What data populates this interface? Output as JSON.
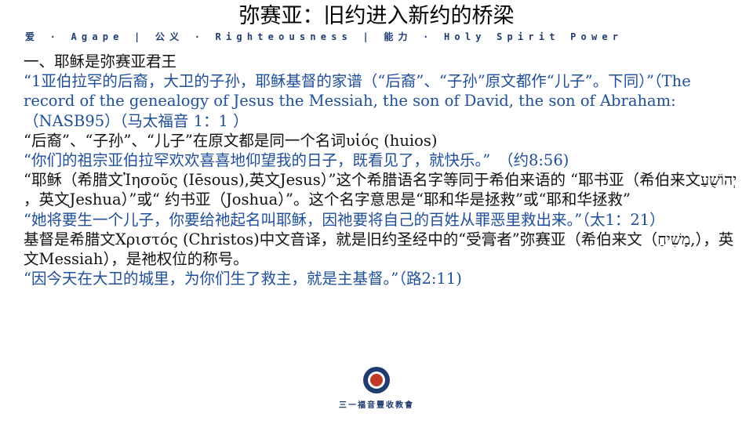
{
  "title": "弥赛亚：旧约进入新约的桥梁",
  "motto": "爱 · Agape | 公义 · Righteousness | 能力 · Holy Spirit Power",
  "paragraphs": [
    {
      "style": "heading",
      "text": "一、耶稣是弥赛亚君王"
    },
    {
      "style": "blue",
      "text": "“1亚伯拉罕的后裔，大卫的子孙，耶稣基督的家谱（“后裔”、“子孙”原文都作“儿子”。下同）”（The record of the genealogy of Jesus the Messiah, the son of David, the son of Abraham:（NASB95）（马太福音 1：1 ）"
    },
    {
      "style": "black",
      "text": "“后裔”、“子孙”、“儿子”在原文都是同一个名词υἱός (huios)"
    },
    {
      "style": "blue",
      "text": "“你们的祖宗亚伯拉罕欢欢喜喜地仰望我的日子，既看见了，就快乐。”　（约8:56)"
    },
    {
      "style": "black",
      "text": "“耶稣（希腊文Ἰησοῦς (Iēsous),英文Jesus）”这个希腊语名字等同于希伯来语的 “耶书亚（希伯来文יְהוֹשֻׁעַ ，英文Jeshua）”或“ 约书亚（Joshua）”。这个名字意思是“耶和华是拯救”或“耶和华拯救”"
    },
    {
      "style": "blue",
      "text": "“她将要生一个儿子，你要给祂起名叫耶稣，因祂要将自己的百姓从罪恶里救出来。”（太1：21）"
    },
    {
      "style": "black",
      "text": "基督是希腊文Χριστός (Christos)中文音译，就是旧约圣经中的“受膏者”弥赛亚（希伯来文（מָשִׁיחַ,），英文Messiah），是祂权位的称号。"
    },
    {
      "style": "blue",
      "text": "“因今天在大卫的城里，为你们生了救主，就是主基督。”（路2:11)"
    }
  ],
  "footer": {
    "church_name": "三一福音豐收教會",
    "logo_icon": "church-logo-icon"
  },
  "colors": {
    "blue_text": "#1f4e9a",
    "motto": "#1f3b70"
  }
}
